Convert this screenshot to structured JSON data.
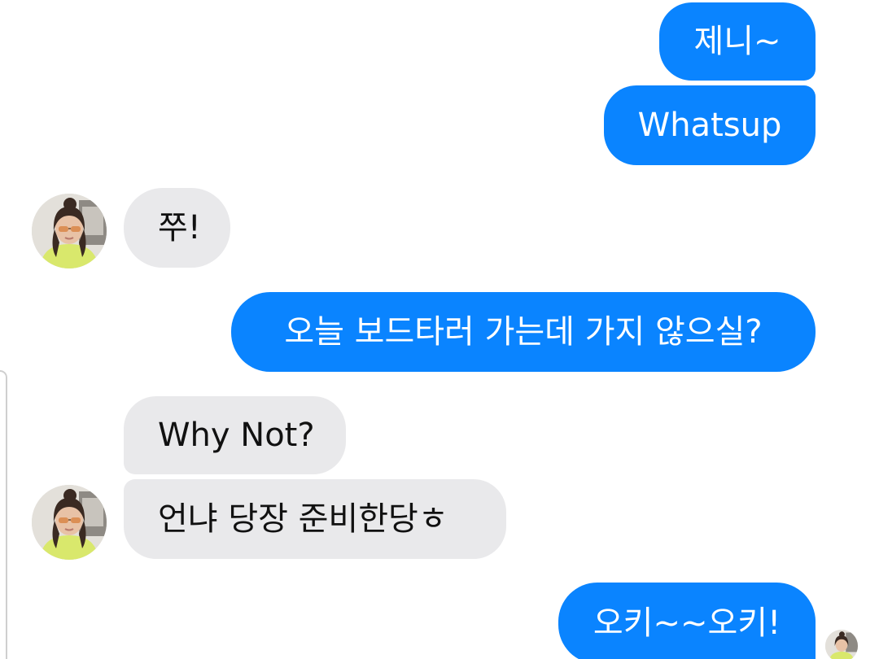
{
  "conversation": {
    "messages": [
      {
        "from": "me",
        "text": "제니~"
      },
      {
        "from": "me",
        "text": "Whatsup"
      },
      {
        "from": "contact",
        "text": "쭈!"
      },
      {
        "from": "me",
        "text": "오늘 보드타러 가는데 가지 않으실?"
      },
      {
        "from": "contact",
        "text": "Why Not?"
      },
      {
        "from": "contact",
        "text": "언냐 당장 준비한당ㅎ"
      },
      {
        "from": "me",
        "text": "오키~~오키!"
      }
    ]
  },
  "colors": {
    "outgoing_bubble": "#0a84ff",
    "incoming_bubble": "#e9e9eb",
    "outgoing_text": "#ffffff",
    "incoming_text": "#111111"
  },
  "icons": {
    "contact_avatar": "contact-avatar-photo",
    "read_receipt": "read-receipt-avatar"
  }
}
